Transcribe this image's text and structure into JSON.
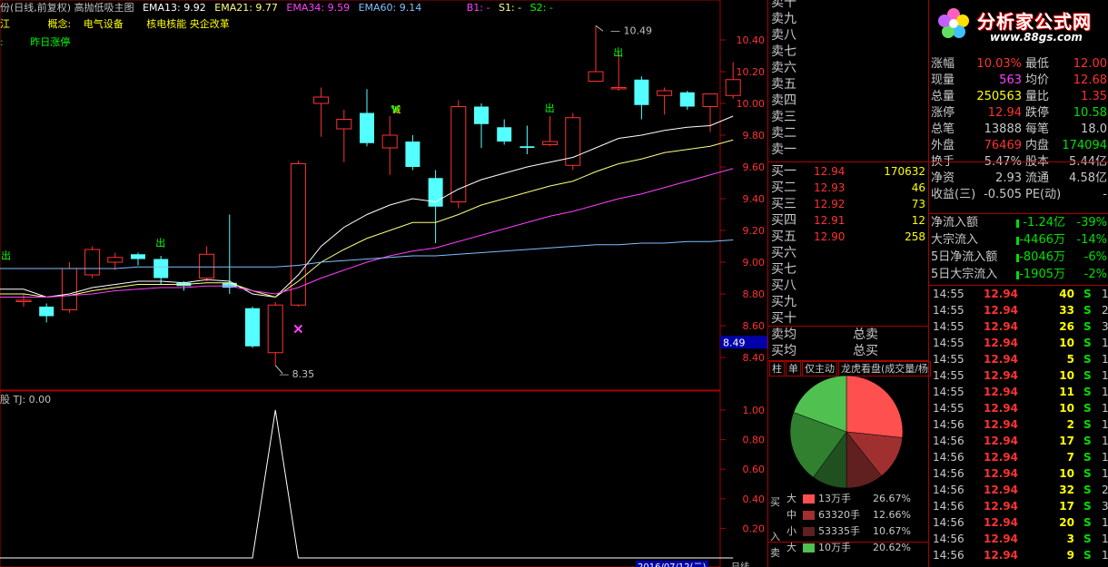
{
  "header": {
    "title": "份(日线,前复权) 高抛低吸主图",
    "ema13": "EMA13: 9.92",
    "ema21": "EMA21: 9.77",
    "ema34": "EMA34: 9.59",
    "ema60": "EMA60: 9.14",
    "b1": "B1: -",
    "s1": "S1: -",
    "s2": "S2: -",
    "concept_prefix": "江",
    "concept_label": "概念:",
    "concept_values": "电气设备",
    "concept_values2": "核电核能 央企改革",
    "prev_label": ":",
    "prev_value": "昨日涨停"
  },
  "colors": {
    "up": "#ff3232",
    "down": "#54ffff",
    "ema13": "#ffffff",
    "ema21": "#ffff80",
    "ema34": "#ff40ff",
    "ema60": "#80c0ff",
    "accent_red": "#aa0000"
  },
  "price_axis": [
    "10.40",
    "10.20",
    "10.00",
    "9.80",
    "9.60",
    "9.40",
    "9.20",
    "9.00",
    "8.80",
    "8.60",
    "8.40"
  ],
  "current_price_tag": "8.49",
  "annotations": {
    "high_label": "10.49",
    "low_label": "8.35",
    "signal_out": "出",
    "signal_cheng": "诚"
  },
  "indicator": {
    "title": "股 TJ: 0.00",
    "axis": [
      "1.00",
      "0.80",
      "0.60",
      "0.40",
      "0.20"
    ]
  },
  "footer": {
    "date_label": "2016/07/12(二)",
    "day_label": "日线"
  },
  "chart_data": {
    "type": "candlestick",
    "x_label": "",
    "ylim": [
      8.3,
      10.55
    ],
    "candles": [
      {
        "o": 8.76,
        "c": 8.76,
        "h": 8.8,
        "l": 8.72
      },
      {
        "o": 8.72,
        "c": 8.66,
        "h": 8.74,
        "l": 8.62
      },
      {
        "o": 8.7,
        "c": 8.96,
        "h": 9.0,
        "l": 8.68
      },
      {
        "o": 8.92,
        "c": 9.08,
        "h": 9.1,
        "l": 8.9
      },
      {
        "o": 9.0,
        "c": 9.03,
        "h": 9.06,
        "l": 8.95
      },
      {
        "o": 9.05,
        "c": 9.02,
        "h": 9.06,
        "l": 8.98
      },
      {
        "o": 9.02,
        "c": 8.9,
        "h": 9.04,
        "l": 8.86
      },
      {
        "o": 8.87,
        "c": 8.85,
        "h": 8.88,
        "l": 8.82
      },
      {
        "o": 8.9,
        "c": 9.05,
        "h": 9.1,
        "l": 8.88
      },
      {
        "o": 8.87,
        "c": 8.84,
        "h": 9.3,
        "l": 8.8
      },
      {
        "o": 8.71,
        "c": 8.47,
        "h": 8.72,
        "l": 8.46
      },
      {
        "o": 8.43,
        "c": 8.73,
        "h": 8.75,
        "l": 8.35
      },
      {
        "o": 8.73,
        "c": 9.62,
        "h": 9.64,
        "l": 8.72
      },
      {
        "o": 10.0,
        "c": 10.04,
        "h": 10.1,
        "l": 9.79
      },
      {
        "o": 9.84,
        "c": 9.9,
        "h": 9.96,
        "l": 9.63
      },
      {
        "o": 9.94,
        "c": 9.75,
        "h": 10.09,
        "l": 9.73
      },
      {
        "o": 9.72,
        "c": 9.8,
        "h": 9.92,
        "l": 9.55
      },
      {
        "o": 9.76,
        "c": 9.6,
        "h": 9.8,
        "l": 9.58
      },
      {
        "o": 9.53,
        "c": 9.35,
        "h": 9.58,
        "l": 9.12
      },
      {
        "o": 9.38,
        "c": 9.98,
        "h": 10.02,
        "l": 9.34
      },
      {
        "o": 9.98,
        "c": 9.87,
        "h": 10.0,
        "l": 9.72
      },
      {
        "o": 9.85,
        "c": 9.76,
        "h": 9.9,
        "l": 9.74
      },
      {
        "o": 9.73,
        "c": 9.72,
        "h": 9.86,
        "l": 9.68
      },
      {
        "o": 9.74,
        "c": 9.76,
        "h": 9.92,
        "l": 9.73
      },
      {
        "o": 9.61,
        "c": 9.91,
        "h": 9.94,
        "l": 9.58
      },
      {
        "o": 10.14,
        "c": 10.2,
        "h": 10.49,
        "l": 10.14
      },
      {
        "o": 10.1,
        "c": 10.1,
        "h": 10.32,
        "l": 10.08
      },
      {
        "o": 10.15,
        "c": 9.99,
        "h": 10.17,
        "l": 9.9
      },
      {
        "o": 10.05,
        "c": 10.08,
        "h": 10.1,
        "l": 9.93
      },
      {
        "o": 10.07,
        "c": 9.98,
        "h": 10.08,
        "l": 9.96
      },
      {
        "o": 9.98,
        "c": 10.06,
        "h": 10.06,
        "l": 9.82
      },
      {
        "o": 10.05,
        "c": 10.15,
        "h": 10.26,
        "l": 10.03
      }
    ],
    "series": [
      {
        "values": [
          8.83,
          8.78,
          8.8,
          8.84,
          8.86,
          8.88,
          8.88,
          8.87,
          8.89,
          8.88,
          8.8,
          8.78,
          8.92,
          9.1,
          9.22,
          9.3,
          9.36,
          9.4,
          9.38,
          9.46,
          9.52,
          9.56,
          9.6,
          9.63,
          9.66,
          9.72,
          9.78,
          9.8,
          9.83,
          9.85,
          9.86,
          9.92
        ]
      },
      {
        "values": [
          8.8,
          8.78,
          8.79,
          8.82,
          8.84,
          8.86,
          8.86,
          8.86,
          8.87,
          8.87,
          8.82,
          8.78,
          8.88,
          9.0,
          9.08,
          9.15,
          9.2,
          9.25,
          9.25,
          9.3,
          9.36,
          9.4,
          9.44,
          9.48,
          9.51,
          9.57,
          9.62,
          9.65,
          9.69,
          9.71,
          9.73,
          9.77
        ]
      },
      {
        "values": [
          8.78,
          8.78,
          8.79,
          8.8,
          8.82,
          8.83,
          8.84,
          8.84,
          8.85,
          8.85,
          8.82,
          8.8,
          8.84,
          8.9,
          8.95,
          9.0,
          9.04,
          9.07,
          9.09,
          9.13,
          9.17,
          9.21,
          9.25,
          9.29,
          9.32,
          9.36,
          9.4,
          9.43,
          9.47,
          9.51,
          9.55,
          9.59
        ]
      },
      {
        "values": [
          8.96,
          8.96,
          8.96,
          8.96,
          8.96,
          8.97,
          8.97,
          8.97,
          8.97,
          8.97,
          8.97,
          8.97,
          8.98,
          9.0,
          9.01,
          9.02,
          9.03,
          9.04,
          9.04,
          9.05,
          9.06,
          9.07,
          9.08,
          9.09,
          9.1,
          9.11,
          9.11,
          9.12,
          9.12,
          9.13,
          9.13,
          9.14
        ]
      }
    ],
    "tj_values": [
      0,
      0,
      0,
      0,
      0,
      0,
      0,
      0,
      0,
      0,
      0,
      1,
      0,
      0,
      0,
      0,
      0,
      0,
      0,
      0,
      0,
      0,
      0,
      0,
      0,
      0,
      0,
      0,
      0,
      0,
      0,
      0
    ]
  },
  "orderbook": {
    "sell": [
      {
        "label": "卖十"
      },
      {
        "label": "卖九"
      },
      {
        "label": "卖八"
      },
      {
        "label": "卖七"
      },
      {
        "label": "卖六"
      },
      {
        "label": "卖五"
      },
      {
        "label": "卖四"
      },
      {
        "label": "卖三"
      },
      {
        "label": "卖二"
      },
      {
        "label": "卖一"
      }
    ],
    "buy": [
      {
        "label": "买一",
        "price": "12.94",
        "vol": "170632"
      },
      {
        "label": "买二",
        "price": "12.93",
        "vol": "46"
      },
      {
        "label": "买三",
        "price": "12.92",
        "vol": "73"
      },
      {
        "label": "买四",
        "price": "12.91",
        "vol": "12"
      },
      {
        "label": "买五",
        "price": "12.90",
        "vol": "258"
      },
      {
        "label": "买六"
      },
      {
        "label": "买七"
      },
      {
        "label": "买八"
      },
      {
        "label": "买九"
      },
      {
        "label": "买十"
      }
    ],
    "avg_sell": "卖均",
    "total_sell": "总卖",
    "avg_buy": "买均",
    "total_buy": "总买"
  },
  "tabs": [
    "柱",
    "单",
    "仅主动",
    "龙虎看盘(成交量/杨"
  ],
  "pie_legend": {
    "buy_label": "买",
    "in_label": "入",
    "sell_label": "卖",
    "rows": [
      {
        "size": "大",
        "amount": "13万手",
        "pct": "26.67%",
        "color": "#ff5050"
      },
      {
        "size": "中",
        "amount": "63320手",
        "pct": "12.66%",
        "color": "#a03030"
      },
      {
        "size": "小",
        "amount": "53335手",
        "pct": "10.67%",
        "color": "#602020"
      },
      {
        "size": "大",
        "amount": "10万手",
        "pct": "20.62%",
        "color": "#50c050"
      }
    ]
  },
  "pie": [
    {
      "pct": 26.67,
      "color": "#ff5050"
    },
    {
      "pct": 12.66,
      "color": "#a03030"
    },
    {
      "pct": 10.67,
      "color": "#602020"
    },
    {
      "pct": 10.0,
      "color": "#205020"
    },
    {
      "pct": 20.62,
      "color": "#308030"
    },
    {
      "pct": 19.38,
      "color": "#50c050"
    }
  ],
  "stats": [
    {
      "l1": "涨幅",
      "v1": "10.03%",
      "c1": "#ff3232",
      "l2": "最低",
      "v2": "12.00",
      "c2": "#ff3232"
    },
    {
      "l1": "现量",
      "v1": "563",
      "c1": "#ff40ff",
      "l2": "均价",
      "v2": "12.68",
      "c2": "#ff3232"
    },
    {
      "l1": "总量",
      "v1": "250563",
      "c1": "#ffff00",
      "l2": "量比",
      "v2": "1.35",
      "c2": "#ff3232"
    },
    {
      "l1": "涨停",
      "v1": "12.94",
      "c1": "#ff3232",
      "l2": "跌停",
      "v2": "10.58",
      "c2": "#00e000"
    },
    {
      "l1": "总笔",
      "v1": "13888",
      "c1": "#c8c8c8",
      "l2": "每笔",
      "v2": "18.0",
      "c2": "#c8c8c8"
    },
    {
      "l1": "外盘",
      "v1": "76469",
      "c1": "#ff3232",
      "l2": "内盘",
      "v2": "174094",
      "c2": "#00e000"
    },
    {
      "l1": "换手",
      "v1": "5.47%",
      "c1": "#c8c8c8",
      "l2": "股本",
      "v2": "5.44亿",
      "c2": "#c8c8c8"
    },
    {
      "l1": "净资",
      "v1": "2.93",
      "c1": "#c8c8c8",
      "l2": "流通",
      "v2": "4.58亿",
      "c2": "#c8c8c8"
    },
    {
      "l1": "收益(三)",
      "v1": "-0.505",
      "c1": "#c8c8c8",
      "l2": "PE(动)",
      "v2": "-",
      "c2": "#c8c8c8"
    }
  ],
  "flows": [
    {
      "label": "净流入额",
      "value": "-1.24亿",
      "pct": "-39%"
    },
    {
      "label": "大宗流入",
      "value": "-4466万",
      "pct": "-14%"
    },
    {
      "label": "5日净流入额",
      "value": "-8046万",
      "pct": "-6%"
    },
    {
      "label": "5日大宗流入",
      "value": "-1905万",
      "pct": "-2%"
    }
  ],
  "ticks": [
    {
      "t": "14:55",
      "p": "12.94",
      "v": "40",
      "s": "S",
      "n": "1"
    },
    {
      "t": "14:55",
      "p": "12.94",
      "v": "33",
      "s": "S",
      "n": "2"
    },
    {
      "t": "14:55",
      "p": "12.94",
      "v": "26",
      "s": "S",
      "n": "3"
    },
    {
      "t": "14:55",
      "p": "12.94",
      "v": "10",
      "s": "S",
      "n": "1"
    },
    {
      "t": "14:55",
      "p": "12.94",
      "v": "5",
      "s": "S",
      "n": "1"
    },
    {
      "t": "14:55",
      "p": "12.94",
      "v": "10",
      "s": "S",
      "n": "1"
    },
    {
      "t": "14:55",
      "p": "12.94",
      "v": "11",
      "s": "S",
      "n": "1"
    },
    {
      "t": "14:55",
      "p": "12.94",
      "v": "10",
      "s": "S",
      "n": "1"
    },
    {
      "t": "14:56",
      "p": "12.94",
      "v": "2",
      "s": "S",
      "n": "1"
    },
    {
      "t": "14:56",
      "p": "12.94",
      "v": "17",
      "s": "S",
      "n": "1"
    },
    {
      "t": "14:56",
      "p": "12.94",
      "v": "7",
      "s": "S",
      "n": "1"
    },
    {
      "t": "14:56",
      "p": "12.94",
      "v": "10",
      "s": "S",
      "n": "1"
    },
    {
      "t": "14:56",
      "p": "12.94",
      "v": "32",
      "s": "S",
      "n": "2"
    },
    {
      "t": "14:56",
      "p": "12.94",
      "v": "17",
      "s": "S",
      "n": "3"
    },
    {
      "t": "14:56",
      "p": "12.94",
      "v": "20",
      "s": "S",
      "n": "1"
    },
    {
      "t": "14:56",
      "p": "12.94",
      "v": "3",
      "s": "S",
      "n": "1"
    },
    {
      "t": "14:56",
      "p": "12.94",
      "v": "9",
      "s": "S",
      "n": "1"
    }
  ],
  "logo": {
    "text": "分析家公式网",
    "url": "www.88gs.com"
  }
}
